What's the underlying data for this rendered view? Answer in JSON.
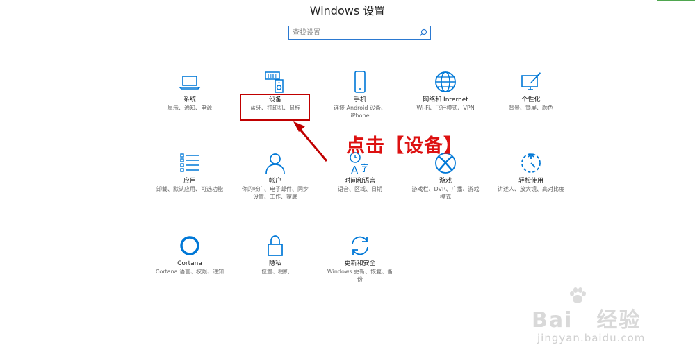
{
  "window": {
    "title": "Windows 设置"
  },
  "search": {
    "placeholder": "查找设置"
  },
  "tiles": [
    {
      "name": "系统",
      "desc": "显示、通知、电源",
      "icon": "laptop-icon"
    },
    {
      "name": "设备",
      "desc": "蓝牙、打印机、鼠标",
      "icon": "keyboard-speaker-icon"
    },
    {
      "name": "手机",
      "desc": "连接 Android 设备、\niPhone",
      "icon": "phone-icon"
    },
    {
      "name": "网络和 Internet",
      "desc": "Wi-Fi、飞行模式、VPN",
      "icon": "globe-icon"
    },
    {
      "name": "个性化",
      "desc": "背景、锁屏、颜色",
      "icon": "paint-icon"
    },
    {
      "name": "应用",
      "desc": "卸载、默认应用、可选功能",
      "icon": "list-icon"
    },
    {
      "name": "帐户",
      "desc": "你的帐户、电子邮件、同步\n设置、工作、家庭",
      "icon": "person-icon"
    },
    {
      "name": "时间和语言",
      "desc": "语音、区域、日期",
      "icon": "time-language-icon"
    },
    {
      "name": "游戏",
      "desc": "游戏栏、DVR、广播、游戏\n模式",
      "icon": "xbox-icon"
    },
    {
      "name": "轻松使用",
      "desc": "讲述人、放大镜、高对比度",
      "icon": "ease-of-access-icon"
    },
    {
      "name": "Cortana",
      "desc": "Cortana 语言、权限、通知",
      "icon": "cortana-icon"
    },
    {
      "name": "隐私",
      "desc": "位置、相机",
      "icon": "lock-icon"
    },
    {
      "name": "更新和安全",
      "desc": "Windows 更新、恢复、备\n份",
      "icon": "sync-icon"
    }
  ],
  "annotation": {
    "text": "点击【设备】"
  },
  "watermark": {
    "brand": "Bai",
    "brand_suffix": "经验",
    "url": "jingyan.baidu.com"
  },
  "colors": {
    "accent": "#0078d7",
    "highlight": "#c00000",
    "annotation": "#dd1111"
  }
}
